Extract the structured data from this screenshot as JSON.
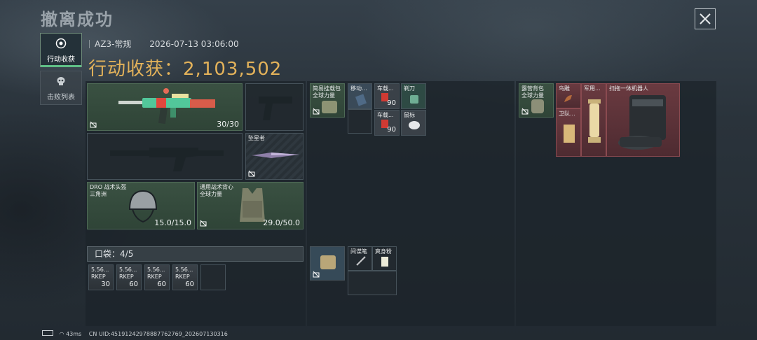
{
  "page_title": "撤离成功",
  "tabs": [
    {
      "label": "行动收获",
      "active": true
    },
    {
      "label": "击败列表",
      "active": false
    }
  ],
  "header": {
    "map": "AZ3-常规",
    "datetime": "2026-07-13 03:06:00",
    "harvest_label": "行动收获：",
    "harvest_value": "2,103,502"
  },
  "equipment": {
    "primary_ammo": "30/30",
    "melee_label": "坠星者",
    "helmet_label": "DRO 战术头盔",
    "helmet_sub": "三角洲",
    "helmet_dur": "15.0/15.0",
    "vest_label": "通用战术背心",
    "vest_sub": "全球力量",
    "vest_dur": "29.0/50.0"
  },
  "pocket": {
    "label": "口袋：",
    "count": "4",
    "capacity": "/5",
    "items": [
      {
        "label": "5.56...",
        "sub": "RKEP",
        "qty": "30"
      },
      {
        "label": "5.56...",
        "sub": "RKEP",
        "qty": "60"
      },
      {
        "label": "5.56...",
        "sub": "RKEP",
        "qty": "60"
      },
      {
        "label": "5.56...",
        "sub": "RKEP",
        "qty": "60"
      }
    ]
  },
  "chest_rig": {
    "title_line1": "简易挂载包",
    "title_line2": "全球力量",
    "items": [
      {
        "label": "移动..."
      },
      {
        "label": "车载...",
        "qty": "90"
      },
      {
        "label": "剃刀"
      },
      {
        "label": "车载...",
        "qty": "90"
      },
      {
        "label": "鼠标"
      }
    ]
  },
  "pouch": {
    "items": [
      {
        "label": "间谍笔"
      },
      {
        "label": "爽身粉"
      }
    ]
  },
  "backpack": {
    "title_line1": "露营背包",
    "title_line2": "全球力量",
    "items": [
      {
        "label": "鸟雕"
      },
      {
        "label": "军用..."
      },
      {
        "label": "扫拖一体机器人"
      },
      {
        "label": "卫队..."
      }
    ]
  },
  "status": {
    "ping": "43ms",
    "uid": "CN UID:451912429788877627​69_202607130316"
  },
  "colors": {
    "gold": "#e3b25a",
    "accent_green": "#5fbf86",
    "legendary_red": "#6a3a40"
  }
}
